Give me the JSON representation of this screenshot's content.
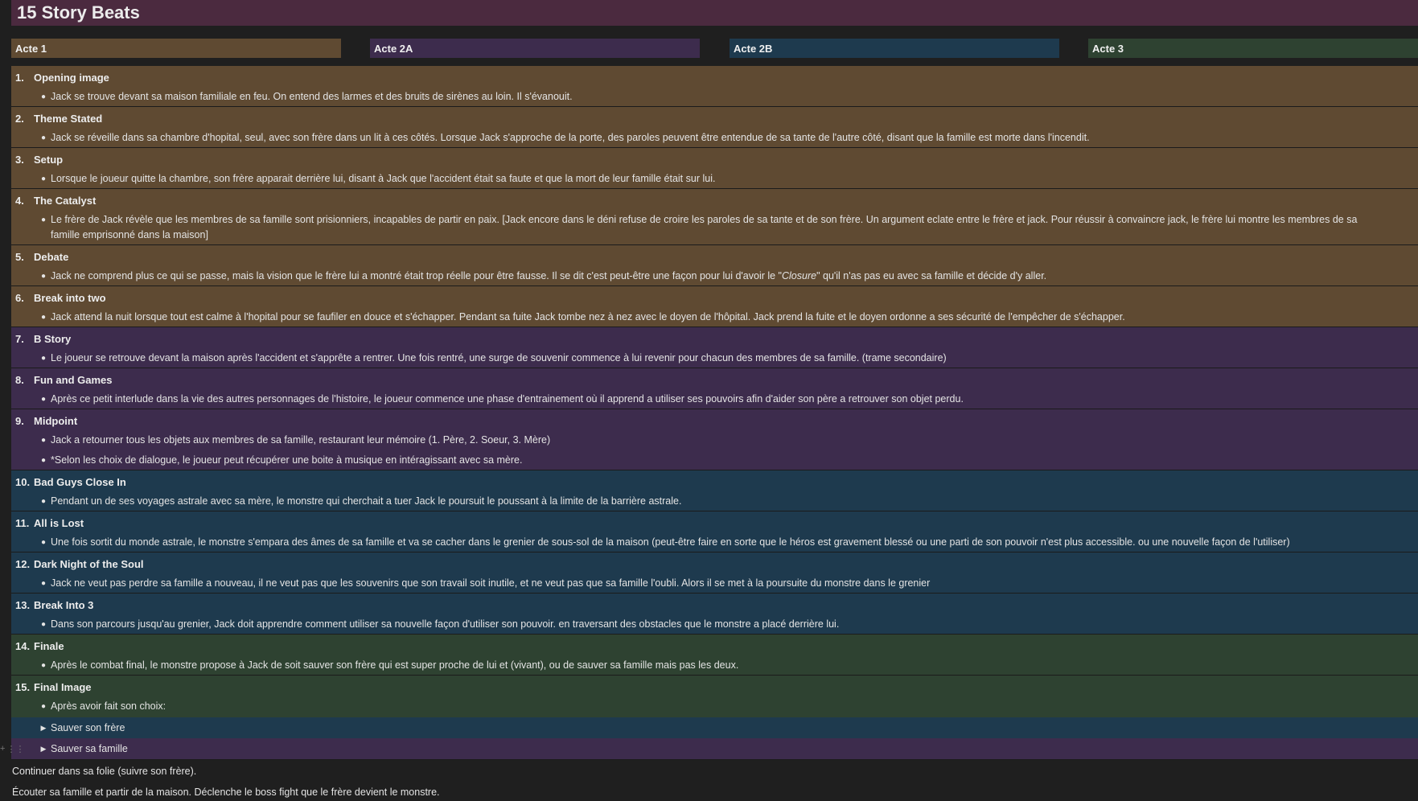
{
  "page": {
    "title": "15 Story Beats"
  },
  "acts": [
    "Acte 1",
    "Acte 2A",
    "Acte 2B",
    "Acte 3"
  ],
  "beats": [
    {
      "num": "1.",
      "title": "Opening image",
      "bullets": [
        "Jack se trouve devant sa maison familiale en feu. On entend des larmes et des bruits de sirènes au loin. Il s'évanouit."
      ]
    },
    {
      "num": "2.",
      "title": "Theme Stated",
      "bullets": [
        "Jack se réveille dans sa chambre d'hopital, seul, avec son frère dans un lit à ces côtés. Lorsque Jack s'approche de la porte, des paroles peuvent être entendue de sa tante de l'autre côté, disant que la famille est morte dans l'incendit."
      ]
    },
    {
      "num": "3.",
      "title": "Setup",
      "bullets": [
        "Lorsque le joueur quitte la chambre, son frère apparait derrière lui, disant à Jack que l'accident était sa faute et que la mort de leur famille était sur lui."
      ]
    },
    {
      "num": "4.",
      "title": "The Catalyst",
      "bullets": [
        "Le frère de Jack révèle que les membres de sa famille sont prisionniers, incapables de partir en paix. [Jack encore dans le déni refuse de croire les paroles de sa tante et de son frère. Un argument eclate entre le frère et jack. Pour réussir à convaincre jack, le frère lui montre les membres de sa famille emprisonné dans la maison]"
      ]
    },
    {
      "num": "5.",
      "title": "Debate",
      "bullet_parts": [
        "Jack ne comprend plus ce qui se passe, mais la vision que le frère lui a montré était trop réelle pour être fausse. Il se dit c'est peut-être une façon pour lui d'avoir le \"",
        "Closure",
        "\" qu'il n'as pas eu avec sa famille et décide d'y aller."
      ]
    },
    {
      "num": "6.",
      "title": "Break into two",
      "bullets": [
        "Jack attend la nuit lorsque tout est calme à l'hopital pour se faufiler en douce et s'échapper. Pendant sa fuite Jack tombe nez à nez avec le doyen de l'hôpital. Jack prend la fuite et le doyen ordonne a ses sécurité de l'empêcher de s'échapper."
      ]
    },
    {
      "num": "7.",
      "title": "B Story",
      "bullets": [
        "Le joueur se retrouve devant la maison après l'accident et s'apprête a rentrer. Une fois rentré, une surge de souvenir commence à lui revenir pour chacun des membres de sa famille. (trame secondaire)"
      ]
    },
    {
      "num": "8.",
      "title": "Fun and Games",
      "bullets": [
        "Après ce petit interlude dans la vie des autres personnages de l'histoire, le joueur commence une phase d'entrainement où il apprend a utiliser ses pouvoirs afin d'aider son père a retrouver son objet perdu."
      ]
    },
    {
      "num": "9.",
      "title": "Midpoint",
      "bullets": [
        "Jack a retourner tous les objets aux membres de sa famille, restaurant leur mémoire (1. Père, 2. Soeur, 3. Mère)",
        "*Selon les choix de dialogue, le joueur peut récupérer une boite à musique en intéragissant avec sa mère."
      ]
    },
    {
      "num": "10.",
      "title": "Bad Guys Close In",
      "bullets": [
        "Pendant un de ses voyages astrale avec sa mère, le monstre qui cherchait a tuer Jack le poursuit le poussant à la limite de la barrière astrale."
      ]
    },
    {
      "num": "11.",
      "title": "All is Lost",
      "bullets": [
        "Une fois sortit du monde astrale, le monstre s'empara des âmes de sa famille et va se cacher dans le grenier de sous-sol de la maison (peut-être faire en sorte que le héros est gravement blessé ou une parti de son pouvoir n'est plus accessible. ou une nouvelle façon de l'utiliser)"
      ]
    },
    {
      "num": "12.",
      "title": "Dark Night of the Soul",
      "bullets": [
        "Jack ne veut pas perdre sa famille a nouveau, il ne veut pas que les souvenirs que son travail soit inutile, et ne veut pas que sa famille l'oubli. Alors il se met à la poursuite du monstre dans le grenier"
      ]
    },
    {
      "num": "13.",
      "title": "Break Into 3",
      "bullets": [
        "Dans son parcours jusqu'au grenier, Jack doit apprendre comment utiliser sa nouvelle façon d'utiliser son pouvoir. en traversant des obstacles que le monstre a placé derrière lui."
      ]
    },
    {
      "num": "14.",
      "title": "Finale",
      "bullets": [
        "Après le combat final, le monstre propose à Jack de soit sauver son frère qui est super proche de lui et (vivant), ou de sauver sa famille mais pas les deux."
      ]
    },
    {
      "num": "15.",
      "title": "Final Image",
      "bullets": [
        "Après avoir fait son choix:"
      ],
      "toggles": [
        "Sauver son frère",
        "Sauver sa famille"
      ]
    }
  ],
  "footer_lines": [
    "Continuer dans sa folie (suivre son frère).",
    "Écouter sa famille et partir de la maison. Déclenche le boss fight que le frère devient le monstre."
  ]
}
